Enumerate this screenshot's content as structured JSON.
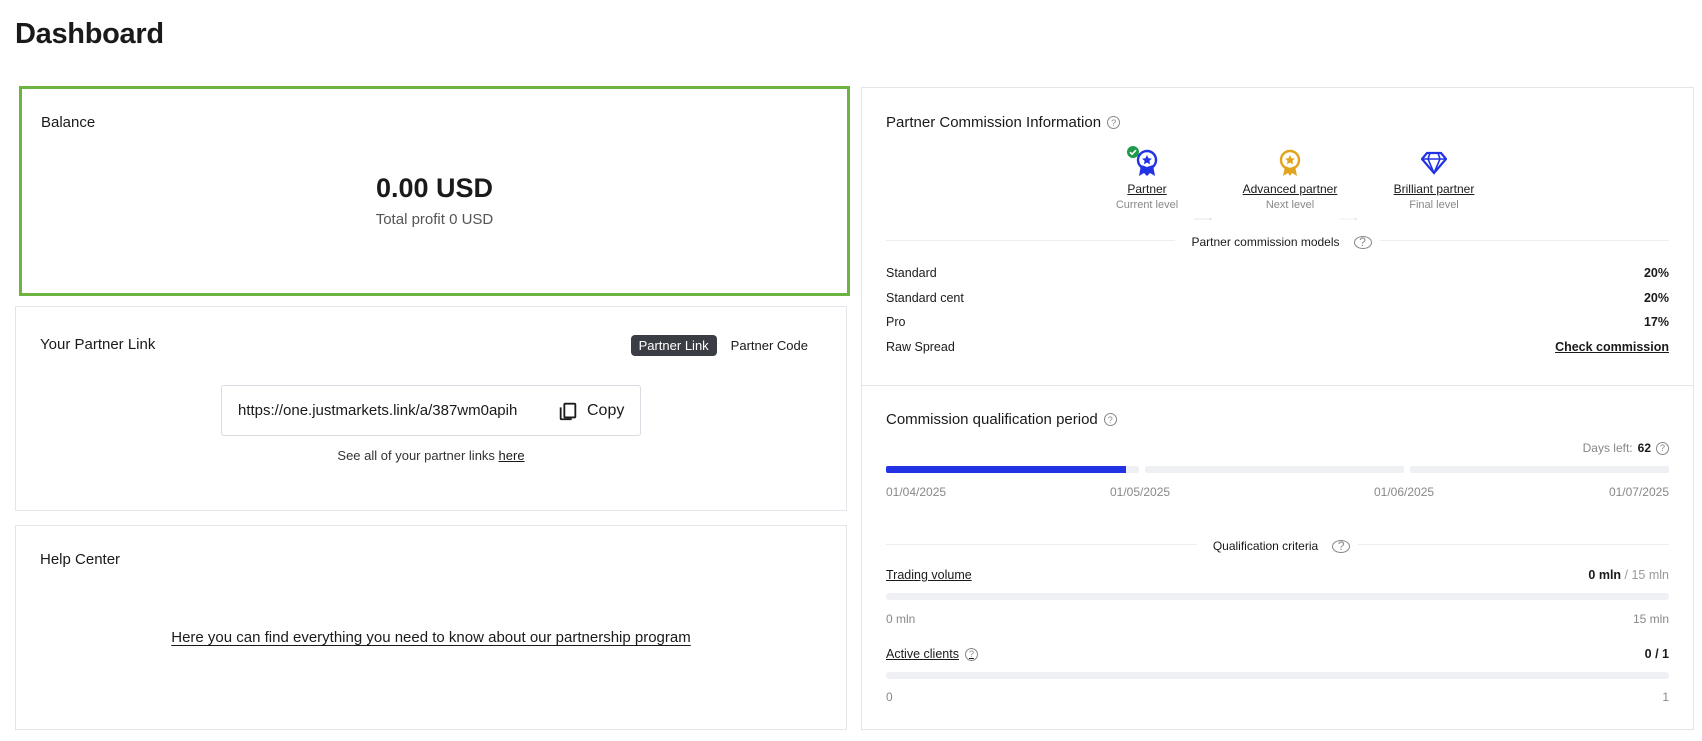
{
  "page": {
    "title": "Dashboard"
  },
  "balance": {
    "title": "Balance",
    "amount": "0.00 USD",
    "profit": "Total profit 0 USD",
    "border_color": "#6cb33f"
  },
  "partner_link": {
    "title": "Your Partner Link",
    "toggle": [
      "Partner Link",
      "Partner Code"
    ],
    "active_toggle": "Partner Link",
    "url": "https://one.justmarkets.link/a/387wm0apih",
    "copy_label": "Copy",
    "see_all_text": "See all of your partner links ",
    "see_all_link": "here"
  },
  "help_center": {
    "title": "Help Center",
    "link_text": "Here you can find everything you need to know about our partnership program"
  },
  "commission": {
    "title": "Partner Commission Information",
    "levels": [
      {
        "name": "Partner",
        "status": "Current level",
        "icon": "ribbon-medal-icon",
        "color": "#2233e6"
      },
      {
        "name": "Advanced partner",
        "status": "Next level",
        "icon": "gold-medal-icon",
        "color": "#e0a51c"
      },
      {
        "name": "Brilliant partner",
        "status": "Final level",
        "icon": "diamond-icon",
        "color": "#2233e6"
      }
    ],
    "models_title": "Partner commission models",
    "models": [
      {
        "name": "Standard",
        "value": "20%"
      },
      {
        "name": "Standard cent",
        "value": "20%"
      },
      {
        "name": "Pro",
        "value": "17%"
      },
      {
        "name": "Raw Spread",
        "value": "Check commission"
      }
    ]
  },
  "qualification": {
    "title": "Commission qualification period",
    "days_left_label": "Days left:",
    "days_left": "62",
    "period_progress": 0.95,
    "dates": [
      "01/04/2025",
      "01/05/2025",
      "01/06/2025",
      "01/07/2025"
    ],
    "criteria_title": "Qualification criteria",
    "trading_volume": {
      "label": "Trading volume",
      "current": "0 mln",
      "target": " / 15 mln",
      "min": "0 mln",
      "max": "15 mln",
      "progress": 0
    },
    "active_clients": {
      "label": "Active clients",
      "current": "0 / 1",
      "min": "0",
      "max": "1",
      "progress": 0
    },
    "accent_color": "#2233e6"
  }
}
